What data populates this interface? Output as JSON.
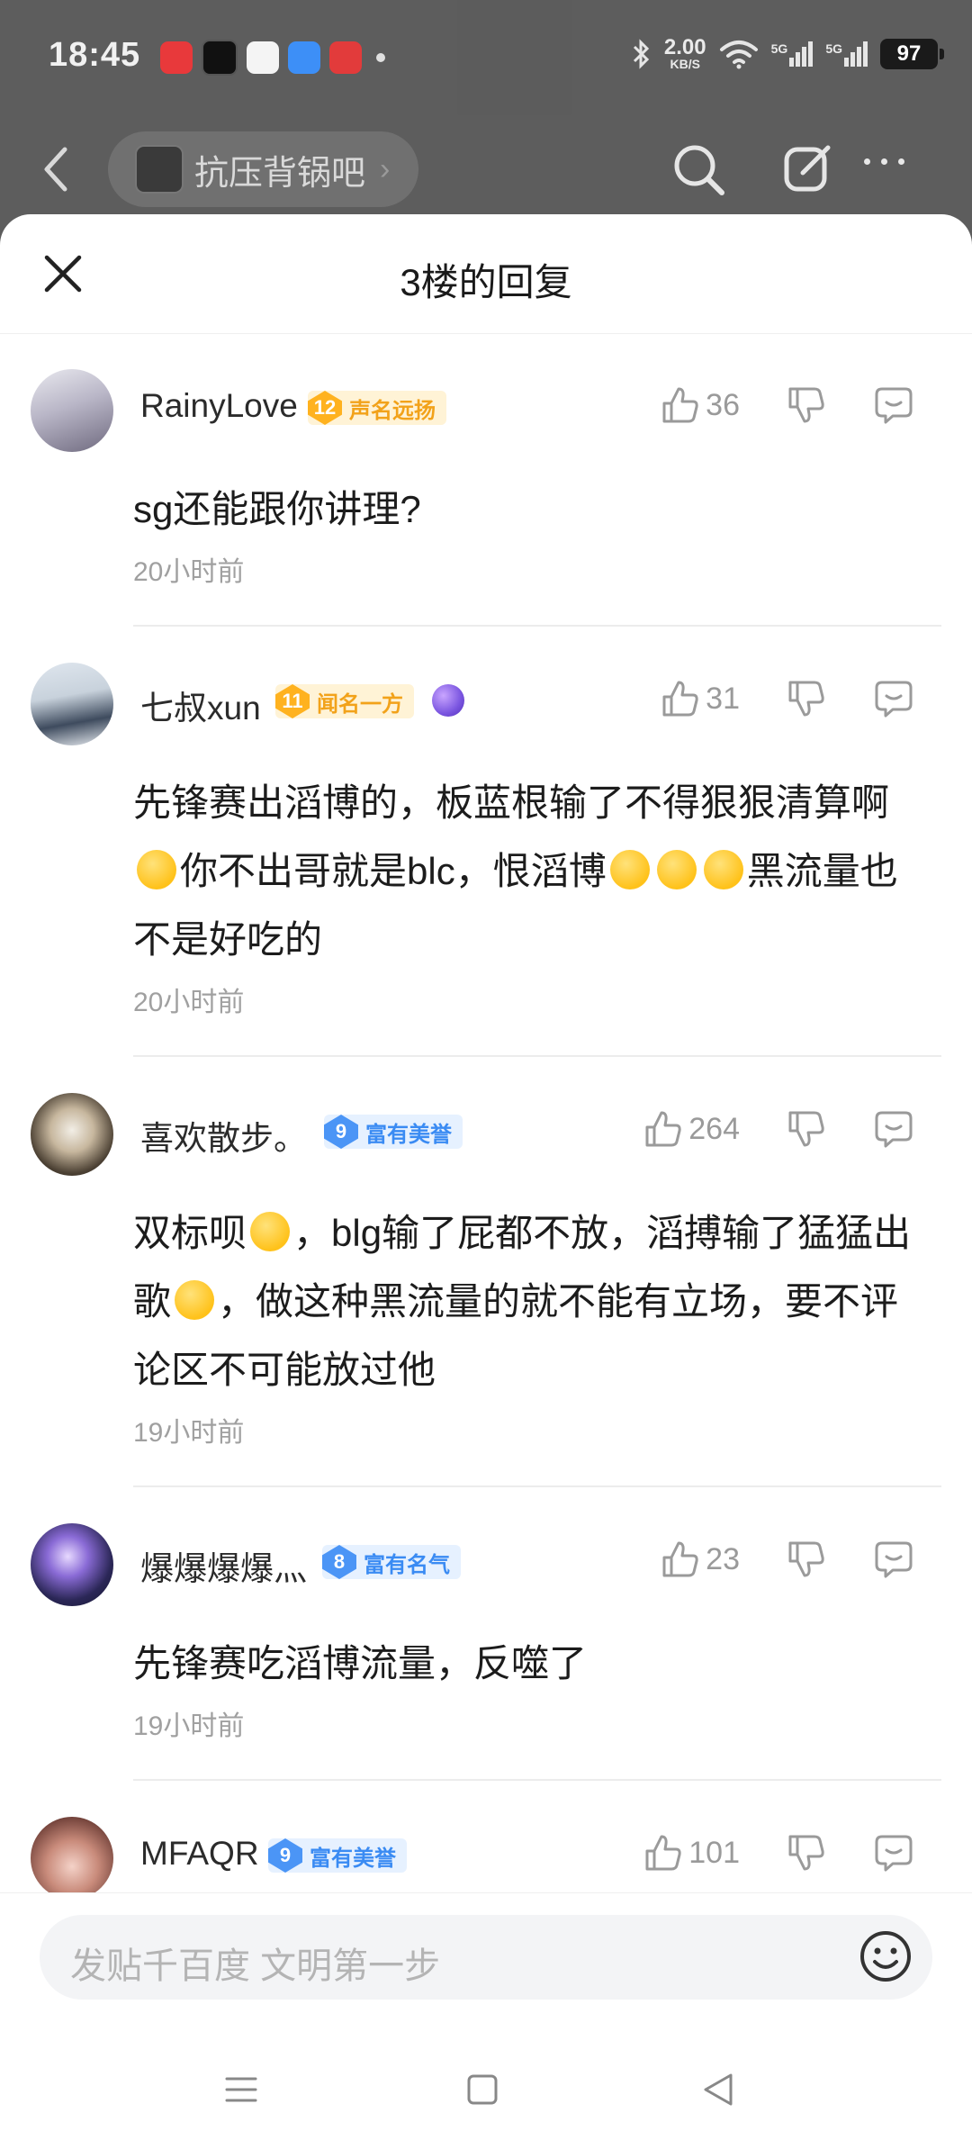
{
  "status_bar": {
    "time": "18:45",
    "net_speed_value": "2.00",
    "net_speed_unit": "KB/S",
    "signal_1": "5G",
    "signal_2": "5G",
    "battery": "97"
  },
  "background_header": {
    "forum_name": "抗压背锅吧"
  },
  "sheet": {
    "title": "3楼的回复"
  },
  "comments": [
    {
      "username": "RainyLove",
      "level": "12",
      "badge_label": "声名远扬",
      "likes": "36",
      "text": "sg还能跟你讲理?",
      "time": "20小时前"
    },
    {
      "username": "七叔xun",
      "level": "11",
      "badge_label": "闻名一方",
      "likes": "31",
      "text_parts": [
        "先锋赛出滔博的，板蓝根输了不得狠狠清算啊",
        "你不出哥就是blc，恨滔博",
        "黑流量也不是好吃的"
      ],
      "time": "20小时前"
    },
    {
      "username": "喜欢散步。",
      "level": "9",
      "badge_label": "富有美誉",
      "likes": "264",
      "text_parts": [
        "双标呗",
        "，blg输了屁都不放，滔搏输了猛猛出歌",
        "，做这种黑流量的就不能有立场，要不评论区不可能放过他"
      ],
      "time": "19小时前"
    },
    {
      "username": "爆爆爆爆灬",
      "level": "8",
      "badge_label": "富有名气",
      "likes": "23",
      "text": "先锋赛吃滔博流量，反噬了",
      "time": "19小时前"
    },
    {
      "username": "MFAQR",
      "level": "9",
      "badge_label": "富有美誉",
      "likes": "101"
    }
  ],
  "input": {
    "placeholder": "发贴千百度 文明第一步"
  },
  "colors": {
    "badge_gold": "#ffb21f",
    "badge_blue": "#4b95f6",
    "icon_gray": "#9a9a9a"
  }
}
